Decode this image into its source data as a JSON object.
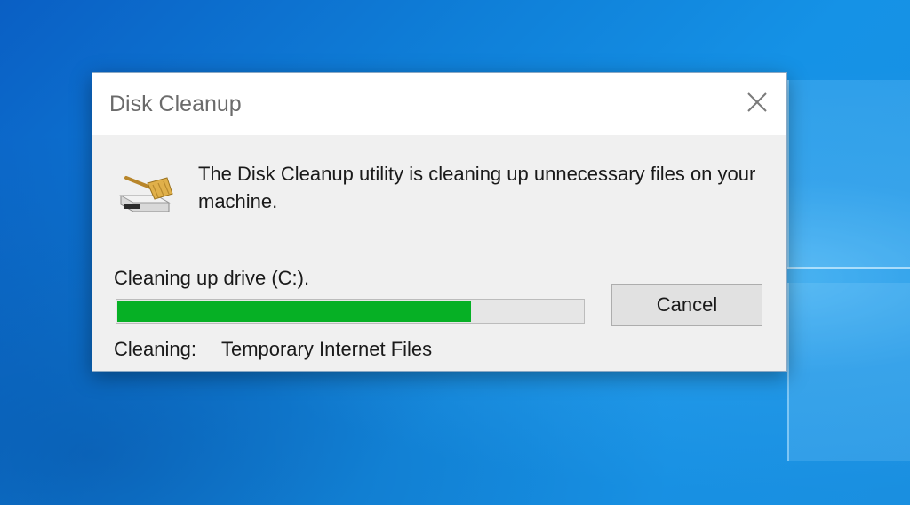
{
  "desktop": {
    "background_color": "#1488e0"
  },
  "dialog": {
    "title": "Disk Cleanup",
    "message": "The Disk Cleanup utility is cleaning up unnecessary files on your machine.",
    "status_text": "Cleaning up drive  (C:).",
    "progress_percent": 76,
    "progress_color": "#06b025",
    "cancel_label": "Cancel",
    "current_label": "Cleaning:",
    "current_item": "Temporary Internet Files",
    "icon": "disk-cleanup-broom-icon",
    "close_icon": "close-icon"
  }
}
